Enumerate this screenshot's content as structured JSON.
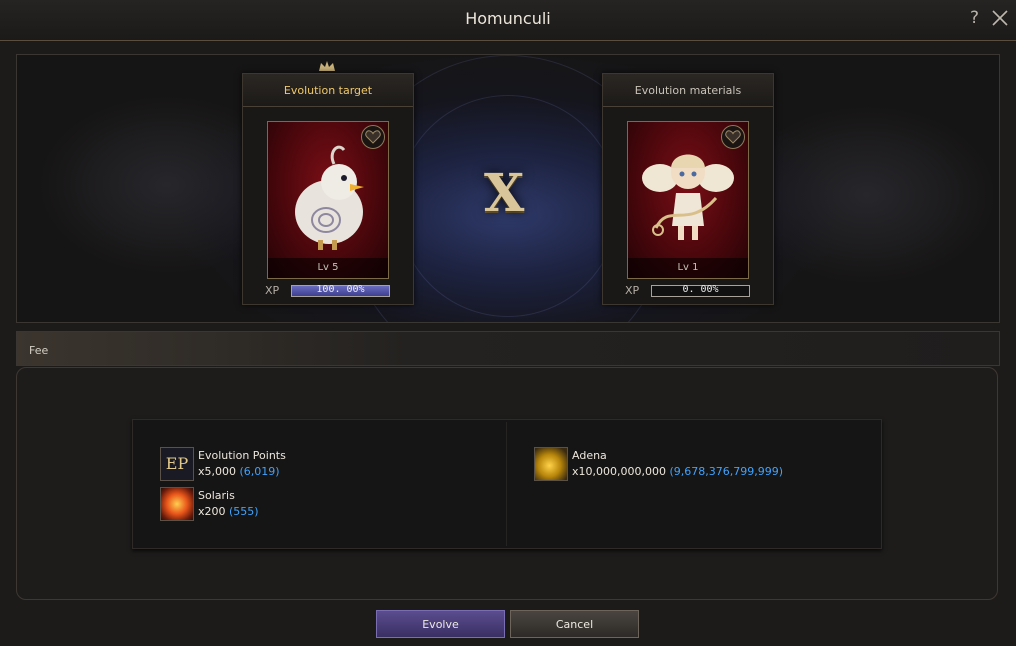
{
  "window": {
    "title": "Homunculi",
    "help_label": "?",
    "close_icon": "close-icon"
  },
  "evolution": {
    "target": {
      "header": "Evolution target",
      "level": "Lv 5",
      "xp_label": "XP",
      "xp_text": "100. 00%",
      "xp_percent": 100
    },
    "materials": {
      "header": "Evolution materials",
      "level": "Lv 1",
      "xp_label": "XP",
      "xp_text": "0. 00%",
      "xp_percent": 0
    },
    "combine_symbol": "X"
  },
  "fee": {
    "label": "Fee",
    "items": [
      {
        "name": "Evolution Points",
        "required": "x5,000",
        "owned": "(6,019)",
        "icon": "evolution-points-icon",
        "icon_text": "EP"
      },
      {
        "name": "Solaris",
        "required": "x200",
        "owned": "(555)",
        "icon": "solaris-icon"
      },
      {
        "name": "Adena",
        "required": "x10,000,000,000",
        "owned": "(9,678,376,799,999)",
        "icon": "adena-icon"
      }
    ]
  },
  "buttons": {
    "evolve": "Evolve",
    "cancel": "Cancel"
  },
  "colors": {
    "owned_value": "#3fa3ff",
    "target_header": "#f0c96a",
    "materials_header": "#c9c3b8"
  }
}
